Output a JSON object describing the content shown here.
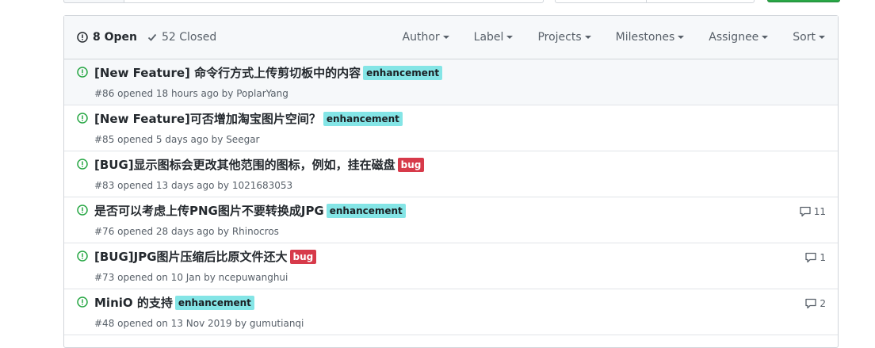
{
  "header": {
    "open_label": "8 Open",
    "closed_label": "52 Closed",
    "filters": [
      "Author",
      "Label",
      "Projects",
      "Milestones",
      "Assignee",
      "Sort"
    ]
  },
  "colors": {
    "open_icon": "#28a745",
    "enhancement_bg": "#84e5e6",
    "bug_bg": "#d73a4a",
    "new_button": "#28a745"
  },
  "issues": [
    {
      "title": "[New Feature] 命令行方式上传剪切板中的内容",
      "label": "enhancement",
      "label_type": "enhancement",
      "number": "#86",
      "opened_text": "opened 18 hours ago by",
      "author": "PoplarYang",
      "comments": ""
    },
    {
      "title": "[New Feature]可否增加淘宝图片空间？",
      "label": "enhancement",
      "label_type": "enhancement",
      "number": "#85",
      "opened_text": "opened 5 days ago by",
      "author": "Seegar",
      "comments": ""
    },
    {
      "title": "[BUG]显示图标会更改其他范围的图标，例如，挂在磁盘",
      "label": "bug",
      "label_type": "bug",
      "number": "#83",
      "opened_text": "opened 13 days ago by",
      "author": "1021683053",
      "comments": ""
    },
    {
      "title": "是否可以考虑上传PNG图片不要转换成JPG",
      "label": "enhancement",
      "label_type": "enhancement",
      "number": "#76",
      "opened_text": "opened 28 days ago by",
      "author": "Rhinocros",
      "comments": "11"
    },
    {
      "title": "[BUG]JPG图片压缩后比原文件还大",
      "label": "bug",
      "label_type": "bug",
      "number": "#73",
      "opened_text": "opened on 10 Jan by",
      "author": "ncepuwanghui",
      "comments": "1"
    },
    {
      "title": "MiniO 的支持",
      "label": "enhancement",
      "label_type": "enhancement",
      "number": "#48",
      "opened_text": "opened on 13 Nov 2019 by",
      "author": "gumutianqi",
      "comments": "2"
    }
  ]
}
